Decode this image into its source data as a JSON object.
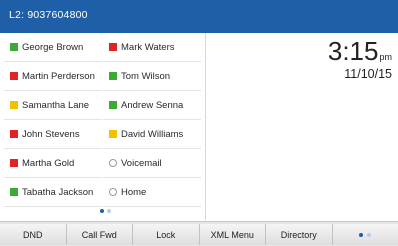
{
  "status_bar": {
    "line_label": "L2: 9037604800"
  },
  "contacts": {
    "left": [
      {
        "name": "George Brown",
        "status": "green"
      },
      {
        "name": "Martin Perderson",
        "status": "red"
      },
      {
        "name": "Samantha Lane",
        "status": "yellow"
      },
      {
        "name": "John Stevens",
        "status": "red"
      },
      {
        "name": "Martha Gold",
        "status": "red"
      },
      {
        "name": "Tabatha Jackson",
        "status": "green"
      }
    ],
    "right": [
      {
        "name": "Mark Waters",
        "status": "red"
      },
      {
        "name": "Tom Wilson",
        "status": "green"
      },
      {
        "name": "Andrew Senna",
        "status": "green"
      },
      {
        "name": "David Williams",
        "status": "yellow"
      },
      {
        "name": "Voicemail",
        "status": "none"
      },
      {
        "name": "Home",
        "status": "none"
      }
    ]
  },
  "status_colors": {
    "green": "#3aaa35",
    "red": "#e02424",
    "yellow": "#f2c200"
  },
  "clock": {
    "time": "3:15",
    "ampm": "pm",
    "date": "11/10/15"
  },
  "softkeys": [
    "DND",
    "Call Fwd",
    "Lock",
    "XML Menu",
    "Directory"
  ],
  "pager": {
    "active_color": "#1f5fa8",
    "inactive_color": "#b7cbe4"
  }
}
